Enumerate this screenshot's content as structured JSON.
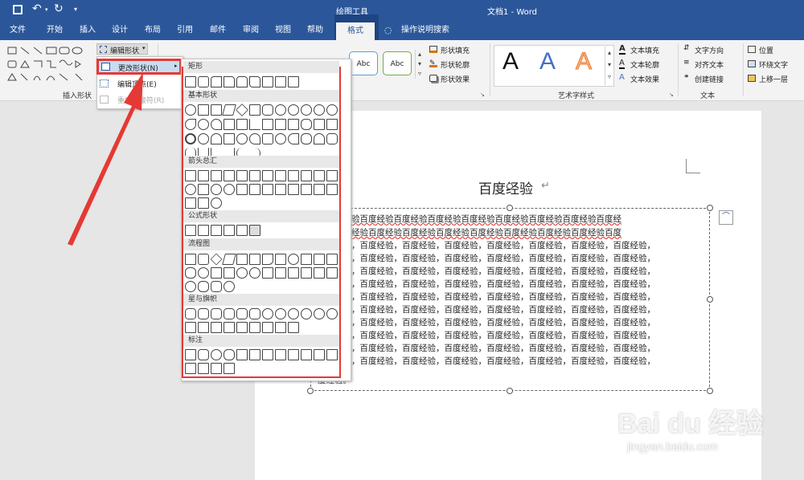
{
  "titlebar": {
    "context_tool": "绘图工具",
    "doc_title": "文档1  -  Word"
  },
  "tabs": [
    "文件",
    "开始",
    "插入",
    "设计",
    "布局",
    "引用",
    "邮件",
    "审阅",
    "视图",
    "帮助",
    "格式"
  ],
  "tell_me": "操作说明搜索",
  "ribbon": {
    "edit_shape_button": "编辑形状",
    "insert_shapes_group": "插入形状",
    "shape_style_abc": "Abc",
    "shape_fill": "形状填充",
    "shape_outline": "形状轮廓",
    "shape_effects": "形状效果",
    "wordart_letter": "A",
    "text_fill": "文本填充",
    "text_outline": "文本轮廓",
    "text_effects": "文本效果",
    "wordart_group": "艺术字样式",
    "text_direction": "文字方向",
    "align_text": "对齐文本",
    "create_link": "创建链接",
    "text_group": "文本",
    "position": "位置",
    "wrap_text": "环绕文字",
    "bring_forward": "上移一层"
  },
  "edit_menu": {
    "change_shape": "更改形状(N)",
    "edit_points": "编辑顶点(E)",
    "reroute": "重排连接符(R)"
  },
  "shapes_gallery": {
    "sections": [
      "矩形",
      "基本形状",
      "箭头总汇",
      "公式形状",
      "流程图",
      "星与旗帜",
      "标注"
    ]
  },
  "document": {
    "heading": "百度经验",
    "para_mark": "↵",
    "first_lines": [
      "验百度经验百度经验百度经验百度经验百度经验百度经验百度经验百度经验百度经",
      "经验百度经验百度经验百度经验百度经验百度经验百度经验百度经验百度经验百度"
    ],
    "body_line": "百度经验，百度经验，百度经验，百度经验，百度经验，百度经验，百度经验，百度经验，",
    "last_line": "度经验。"
  },
  "watermark": {
    "brand": "Bai du 经验",
    "url": "jingyan.baidu.com"
  },
  "colors": {
    "ribbon_blue": "#2b579a",
    "highlight_red": "#e53935"
  }
}
